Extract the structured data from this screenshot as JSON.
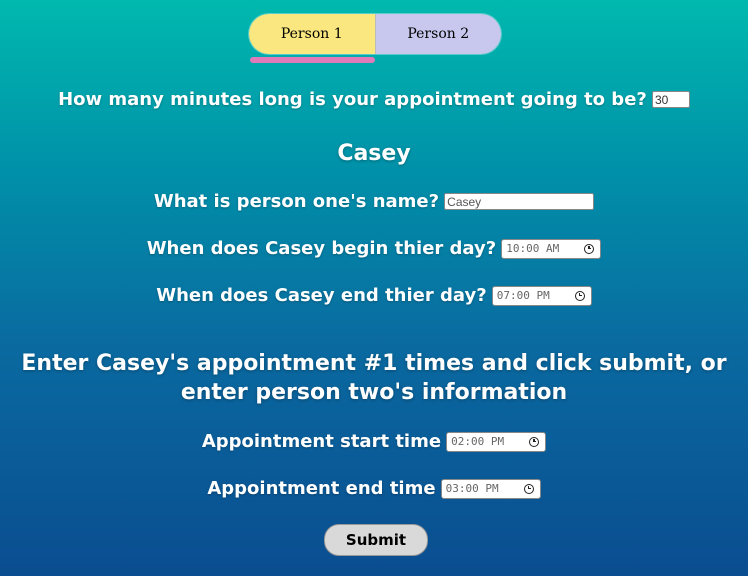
{
  "tabs": [
    {
      "label": "Person 1"
    },
    {
      "label": "Person 2"
    }
  ],
  "appointment_length": {
    "question": "How many minutes long is your appointment going to be?",
    "value": "30"
  },
  "person": {
    "heading": "Casey",
    "name_question": "What is person one's name?",
    "name_value": "Casey",
    "begin_question": "When does Casey begin thier day?",
    "begin_value": "10:00 AM",
    "end_question": "When does Casey end thier day?",
    "end_value": "07:00 PM"
  },
  "instructions": "Enter Casey's appointment #1 times and click submit, or enter person two's information",
  "appointment": {
    "start_label": "Appointment start time",
    "start_value": "02:00 PM",
    "end_label": "Appointment end time",
    "end_value": "03:00 PM"
  },
  "submit_label": "Submit",
  "icons": {
    "time_field": "clock-icon"
  },
  "colors": {
    "tab_active": "#fbe780",
    "tab_inactive": "#c8c8ee",
    "tab_indicator": "#e07ab8"
  }
}
